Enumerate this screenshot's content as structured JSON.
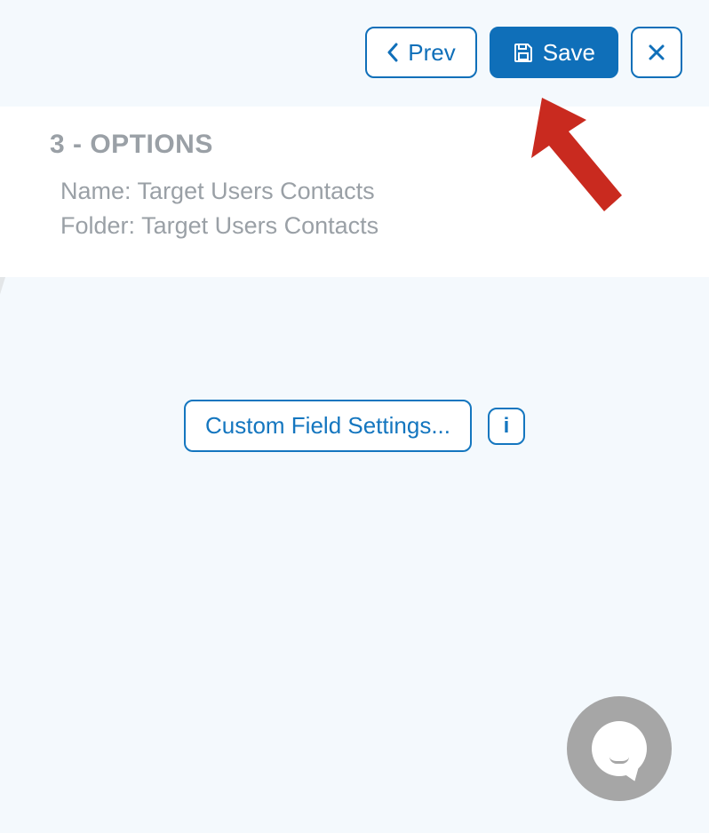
{
  "toolbar": {
    "prev_label": "Prev",
    "save_label": "Save",
    "close_label": "×"
  },
  "step": {
    "heading": "3 - OPTIONS",
    "name_label": "Name:",
    "name_value": "Target Users Contacts",
    "folder_label": "Folder:",
    "folder_value": "Target Users Contacts"
  },
  "settings": {
    "custom_field_label": "Custom Field Settings...",
    "info_glyph": "i"
  },
  "annotation": {
    "arrow_color": "#c92a1f",
    "meaning": "points at Save button"
  },
  "colors": {
    "accent": "#0f6fb9",
    "muted_text": "#9aa0a6",
    "page_bg": "#f4f9fd",
    "fab_bg": "#a6a6a6"
  }
}
